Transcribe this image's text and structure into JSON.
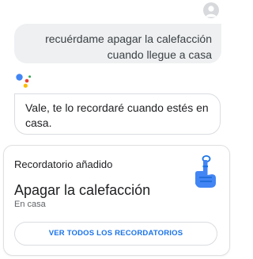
{
  "user_message": {
    "line1": "recuérdame apagar la calefacción",
    "line2": "cuando llegue a casa"
  },
  "assistant_reply": "Vale, te lo recordaré cuando estés en casa.",
  "reminder_card": {
    "header": "Recordatorio añadido",
    "title": "Apagar la calefacción",
    "subtitle": "En casa",
    "button_label": "VER TODOS LOS RECORDATORIOS",
    "icon": "finger-string-icon"
  },
  "icons": {
    "avatar": "user-avatar-icon",
    "assistant": "google-assistant-icon"
  },
  "colors": {
    "accent": "#1a73e8",
    "user_bubble_bg": "#eef0f2",
    "assistant_dot_blue": "#4285f4",
    "assistant_dot_red": "#ea4335",
    "assistant_dot_yellow": "#fbbc04",
    "assistant_dot_green": "#34a853"
  }
}
